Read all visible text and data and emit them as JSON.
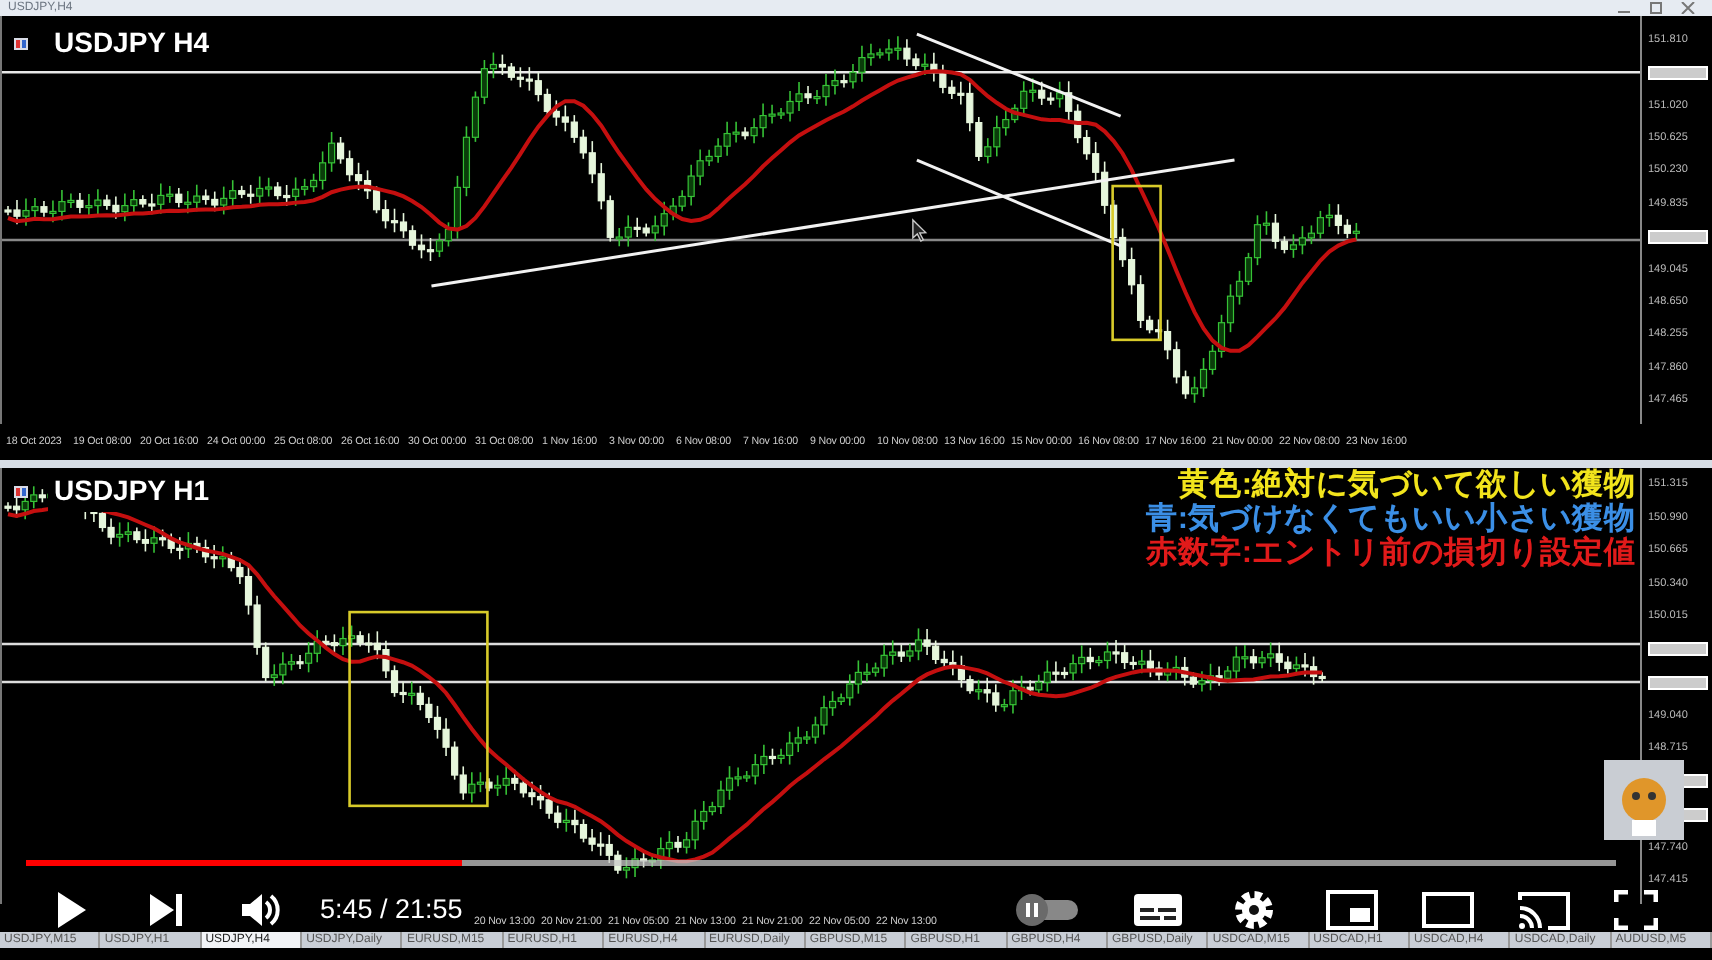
{
  "window_title": "USDJPY,H4",
  "charts": [
    {
      "title": "USDJPY H4",
      "price_axis": [
        {
          "kind": "label",
          "text": "151.810"
        },
        {
          "kind": "tag"
        },
        {
          "kind": "label",
          "text": "151.020"
        },
        {
          "kind": "label",
          "text": "150.625"
        },
        {
          "kind": "label",
          "text": "150.230"
        },
        {
          "kind": "label",
          "text": "149.835"
        },
        {
          "kind": "tag"
        },
        {
          "kind": "label",
          "text": "149.045"
        },
        {
          "kind": "label",
          "text": "148.650"
        },
        {
          "kind": "label",
          "text": "148.255"
        },
        {
          "kind": "label",
          "text": "147.860"
        },
        {
          "kind": "label",
          "text": "147.465"
        }
      ],
      "time_axis": [
        "18 Oct 2023",
        "19 Oct 08:00",
        "20 Oct 16:00",
        "24 Oct 00:00",
        "25 Oct 08:00",
        "26 Oct 16:00",
        "30 Oct 00:00",
        "31 Oct 08:00",
        "1 Nov 16:00",
        "3 Nov 00:00",
        "6 Nov 08:00",
        "7 Nov 16:00",
        "9 Nov 00:00",
        "10 Nov 08:00",
        "13 Nov 16:00",
        "15 Nov 00:00",
        "16 Nov 08:00",
        "17 Nov 16:00",
        "21 Nov 00:00",
        "22 Nov 08:00",
        "23 Nov 16:00"
      ]
    },
    {
      "title": "USDJPY H1",
      "price_axis": [
        {
          "kind": "label",
          "text": "151.315"
        },
        {
          "kind": "label",
          "text": "150.990"
        },
        {
          "kind": "label",
          "text": "150.665"
        },
        {
          "kind": "label",
          "text": "150.340"
        },
        {
          "kind": "label",
          "text": "150.015"
        },
        {
          "kind": "tag"
        },
        {
          "kind": "tag"
        },
        {
          "kind": "label",
          "text": "149.040"
        },
        {
          "kind": "label",
          "text": "148.715"
        },
        {
          "kind": "tag"
        },
        {
          "kind": "tag"
        },
        {
          "kind": "label",
          "text": "147.740"
        },
        {
          "kind": "label",
          "text": "147.415"
        }
      ],
      "time_axis": [
        "20 Nov 13:00",
        "20 Nov 21:00",
        "21 Nov 05:00",
        "21 Nov 13:00",
        "21 Nov 21:00",
        "22 Nov 05:00",
        "22 Nov 13:00"
      ],
      "annotations": [
        {
          "text": "黄色:絶対に気づいて欲しい獲物",
          "color": "#f2e41c"
        },
        {
          "text": "青:気づけなくてもいい小さい獲物",
          "color": "#3b8fe6"
        },
        {
          "text": "赤数字:エントリ前の損切り設定値",
          "color": "#e11a1a"
        }
      ]
    }
  ],
  "player": {
    "progress": {
      "level": 0.274
    },
    "time": "5:45 / 21:55",
    "autoplay_on": false
  },
  "tabs": [
    {
      "label": "USDJPY,M15",
      "selected": false
    },
    {
      "label": "USDJPY,H1",
      "selected": false
    },
    {
      "label": "USDJPY,H4",
      "selected": true
    },
    {
      "label": "USDJPY,Daily",
      "selected": false
    },
    {
      "label": "EURUSD,M15",
      "selected": false
    },
    {
      "label": "EURUSD,H1",
      "selected": false
    },
    {
      "label": "EURUSD,H4",
      "selected": false
    },
    {
      "label": "EURUSD,Daily",
      "selected": false
    },
    {
      "label": "GBPUSD,M15",
      "selected": false
    },
    {
      "label": "GBPUSD,H1",
      "selected": false
    },
    {
      "label": "GBPUSD,H4",
      "selected": false
    },
    {
      "label": "GBPUSD,Daily",
      "selected": false
    },
    {
      "label": "USDCAD,M15",
      "selected": false
    },
    {
      "label": "USDCAD,H1",
      "selected": false
    },
    {
      "label": "USDCAD,H4",
      "selected": false
    },
    {
      "label": "USDCAD,Daily",
      "selected": false
    },
    {
      "label": "AUDUSD,M5",
      "selected": false
    }
  ]
}
